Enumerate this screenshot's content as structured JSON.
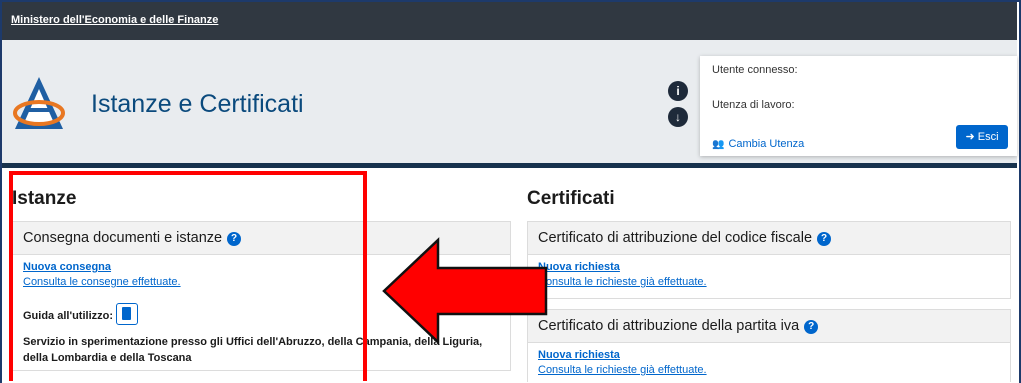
{
  "ministry": {
    "label": "Ministero dell'Economia e delle Finanze"
  },
  "header": {
    "app_title": "Istanze e Certificati",
    "info_icon": "info-icon",
    "download_icon": "download-icon"
  },
  "user_panel": {
    "connected_label": "Utente connesso:",
    "workplace_label": "Utenza di lavoro:",
    "change_user_label": "Cambia Utenza",
    "logout_label": "Esci"
  },
  "istanze": {
    "section_title": "Istanze",
    "panel": {
      "title": "Consegna documenti e istanze",
      "new_link": "Nuova consegna",
      "history_link": "Consulta le consegne effettuate.",
      "guide_label": "Guida all'utilizzo:",
      "notice": "Servizio in sperimentazione presso gli Uffici dell'Abruzzo, della Campania, della Liguria, della Lombardia e della Toscana"
    }
  },
  "certificati": {
    "section_title": "Certificati",
    "panels": [
      {
        "title": "Certificato di attribuzione del codice fiscale",
        "new_link": "Nuova richiesta",
        "history_link": "Consulta le richieste già effettuate."
      },
      {
        "title": "Certificato di attribuzione della partita iva",
        "new_link": "Nuova richiesta",
        "history_link": "Consulta le richieste già effettuate."
      }
    ]
  },
  "colors": {
    "brand_blue": "#0b4a7d",
    "link_blue": "#0066cc",
    "highlight_red": "#ff0000",
    "topbar": "#303841"
  }
}
